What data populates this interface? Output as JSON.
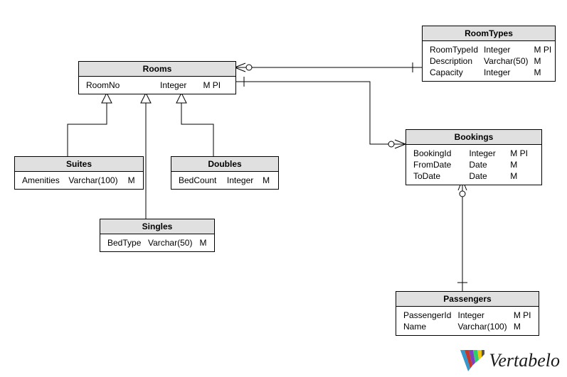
{
  "entities": {
    "rooms": {
      "title": "Rooms",
      "attrs": [
        {
          "name": "RoomNo",
          "type": "Integer",
          "flags": "M PI"
        }
      ]
    },
    "roomtypes": {
      "title": "RoomTypes",
      "attrs": [
        {
          "name": "RoomTypeId",
          "type": "Integer",
          "flags": "M PI"
        },
        {
          "name": "Description",
          "type": "Varchar(50)",
          "flags": "M"
        },
        {
          "name": "Capacity",
          "type": "Integer",
          "flags": "M"
        }
      ]
    },
    "suites": {
      "title": "Suites",
      "attrs": [
        {
          "name": "Amenities",
          "type": "Varchar(100)",
          "flags": "M"
        }
      ]
    },
    "doubles": {
      "title": "Doubles",
      "attrs": [
        {
          "name": "BedCount",
          "type": "Integer",
          "flags": "M"
        }
      ]
    },
    "singles": {
      "title": "Singles",
      "attrs": [
        {
          "name": "BedType",
          "type": "Varchar(50)",
          "flags": "M"
        }
      ]
    },
    "bookings": {
      "title": "Bookings",
      "attrs": [
        {
          "name": "BookingId",
          "type": "Integer",
          "flags": "M PI"
        },
        {
          "name": "FromDate",
          "type": "Date",
          "flags": "M"
        },
        {
          "name": "ToDate",
          "type": "Date",
          "flags": "M"
        }
      ]
    },
    "passengers": {
      "title": "Passengers",
      "attrs": [
        {
          "name": "PassengerId",
          "type": "Integer",
          "flags": "M PI"
        },
        {
          "name": "Name",
          "type": "Varchar(100)",
          "flags": "M"
        }
      ]
    }
  },
  "logo_text": "Vertabelo"
}
